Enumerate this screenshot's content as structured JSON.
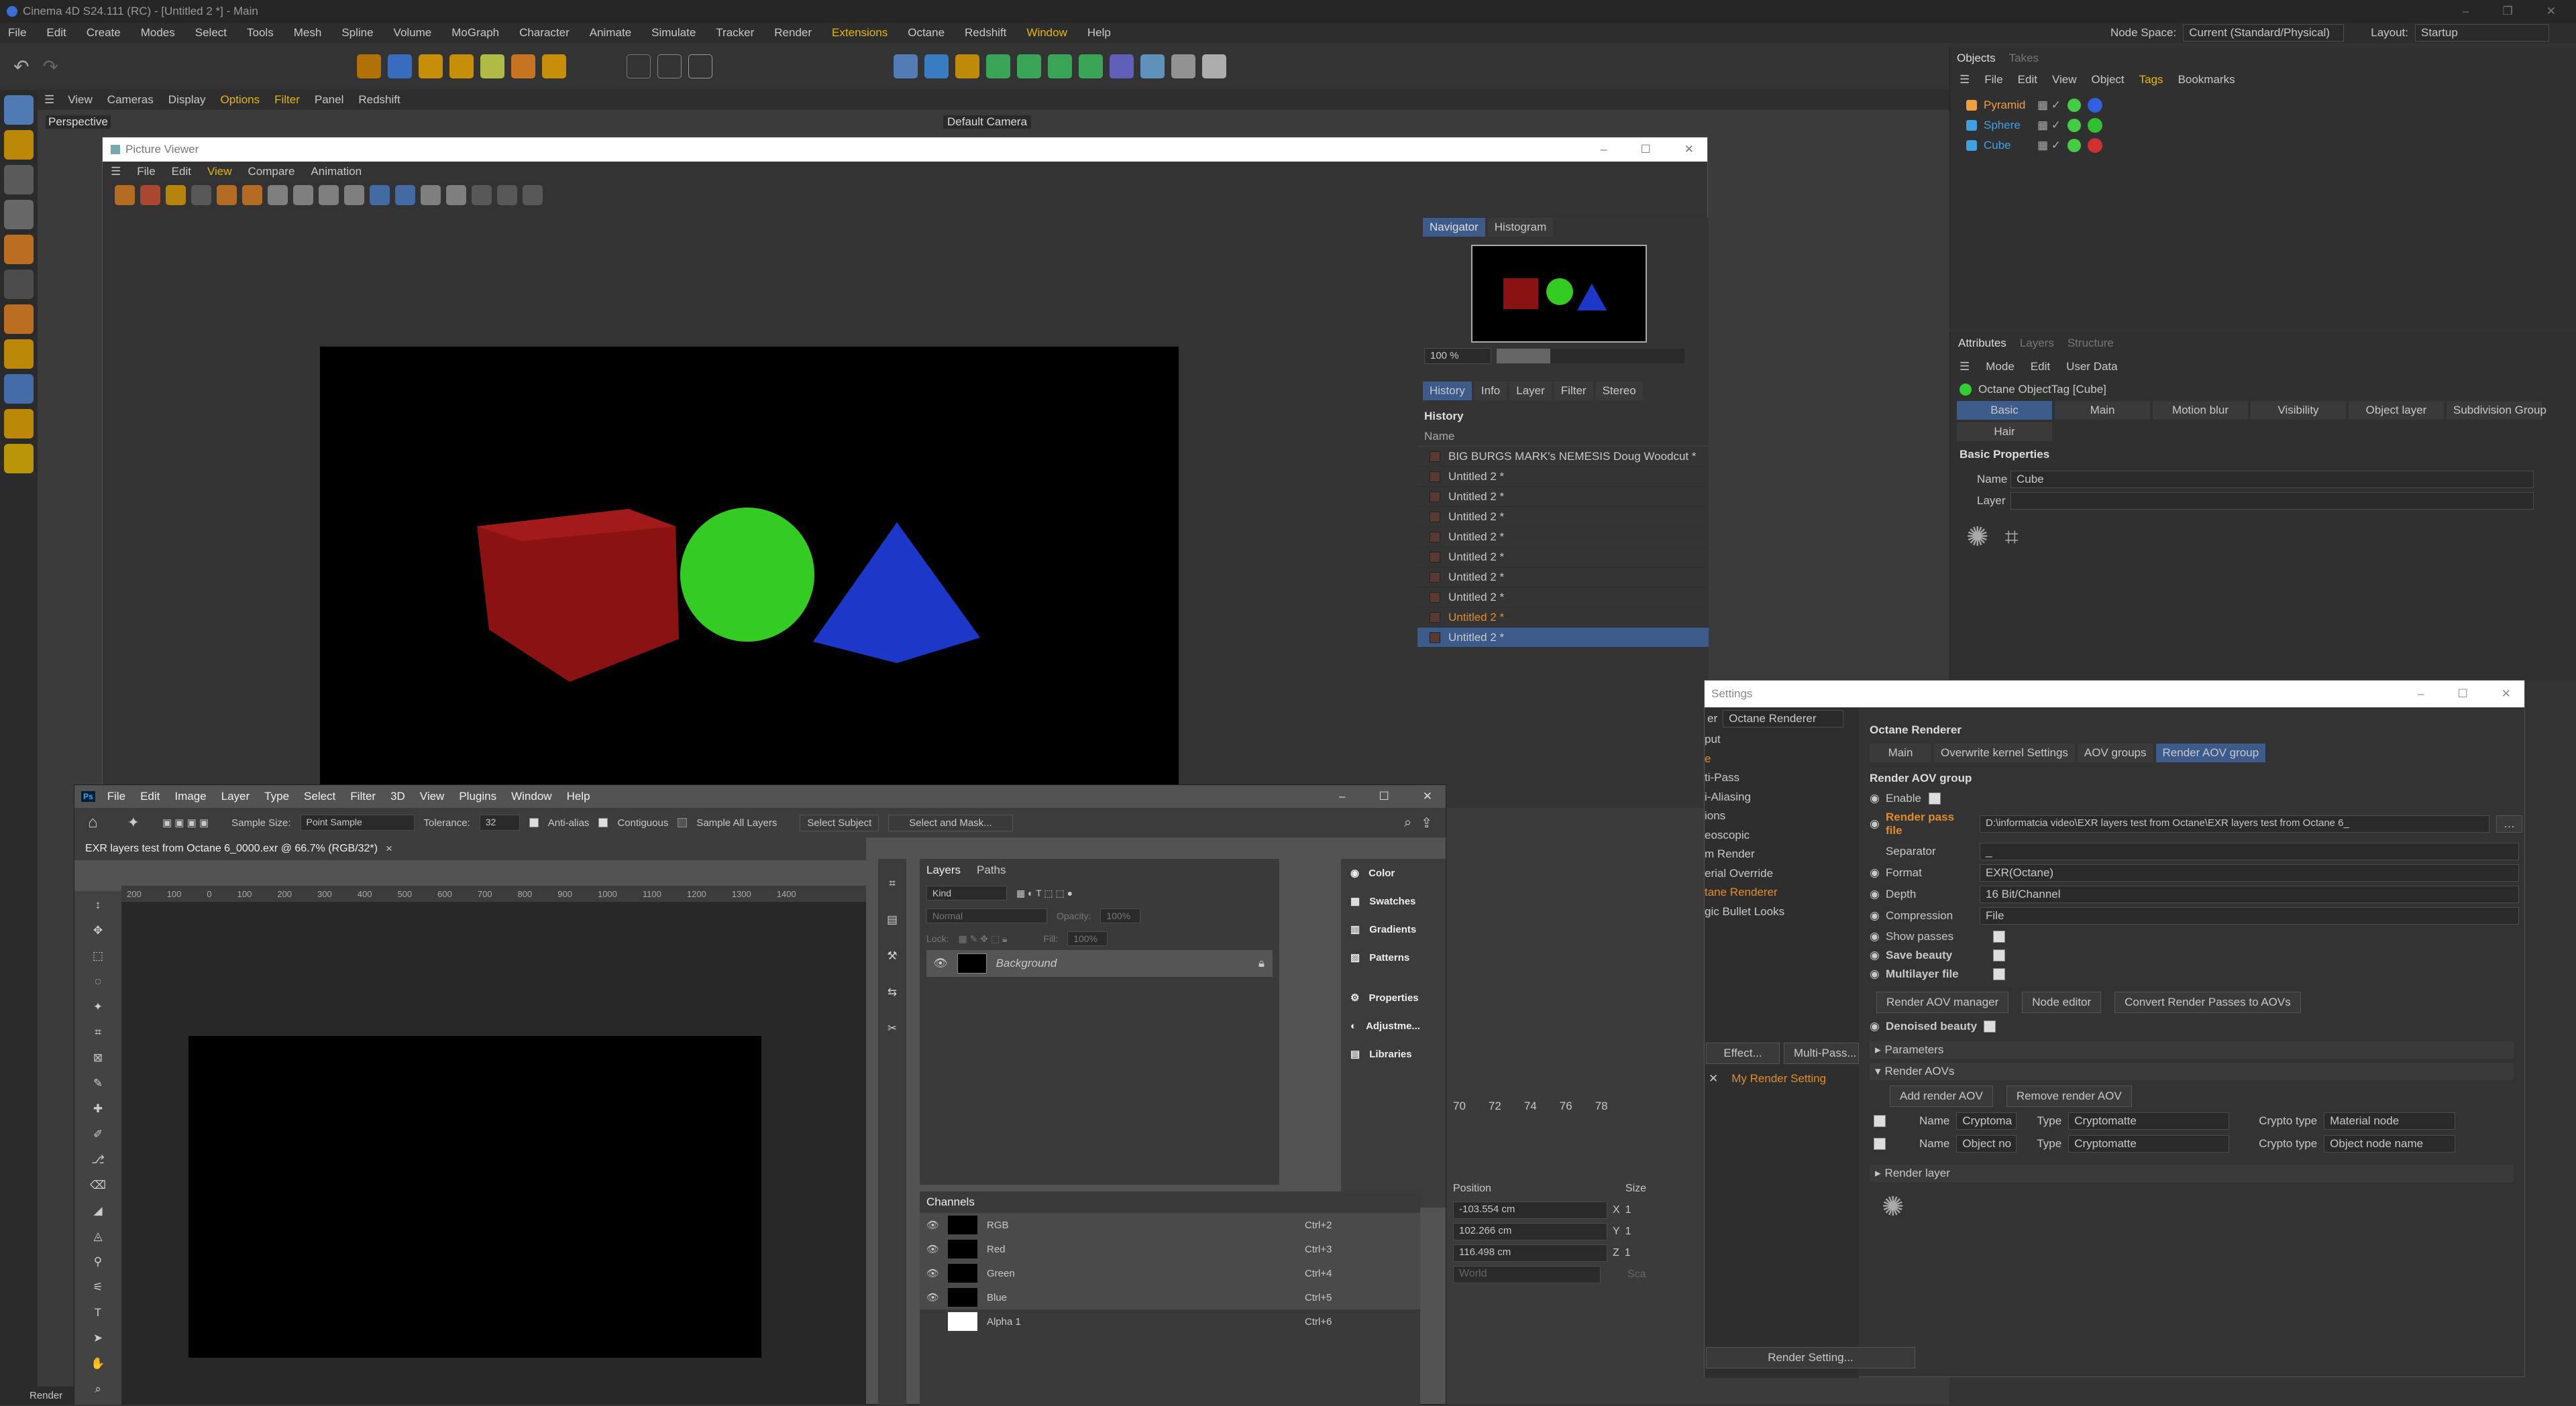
{
  "titlebar": {
    "title": "Cinema 4D S24.111 (RC) - [Untitled 2 *] - Main"
  },
  "menubar": {
    "items": [
      "File",
      "Edit",
      "Create",
      "Modes",
      "Select",
      "Tools",
      "Mesh",
      "Spline",
      "Volume",
      "MoGraph",
      "Character",
      "Animate",
      "Simulate",
      "Tracker",
      "Render",
      "Extensions",
      "Octane",
      "Redshift",
      "Window",
      "Help"
    ],
    "node_space_label": "Node Space:",
    "node_space_value": "Current (Standard/Physical)",
    "layout_label": "Layout:",
    "layout_value": "Startup"
  },
  "viewport": {
    "menu": [
      "View",
      "Cameras",
      "Display",
      "Options",
      "Filter",
      "Panel",
      "Redshift"
    ],
    "label": "Perspective",
    "camera": "Default Camera"
  },
  "objects_panel": {
    "tabs": [
      "Objects",
      "Takes"
    ],
    "menu": [
      "File",
      "Edit",
      "View",
      "Object",
      "Tags",
      "Bookmarks"
    ],
    "objects": [
      {
        "name": "Pyramid",
        "color": "#f0a040",
        "tag": "#3060e0"
      },
      {
        "name": "Sphere",
        "color": "#40a0e0",
        "tag": "#30c030"
      },
      {
        "name": "Cube",
        "color": "#40a0e0",
        "tag": "#d03030"
      }
    ]
  },
  "attributes": {
    "tabs": [
      "Attributes",
      "Layers",
      "Structure"
    ],
    "menu": [
      "Mode",
      "Edit",
      "User Data"
    ],
    "tag_title": "Octane ObjectTag [Cube]",
    "subtabs": [
      "Basic",
      "Main",
      "Motion blur",
      "Visibility",
      "Object layer",
      "Subdivision Group"
    ],
    "subtab2": "Hair",
    "section": "Basic Properties",
    "name_label": "Name",
    "name_value": "Cube",
    "layer_label": "Layer"
  },
  "picture_viewer": {
    "title": "Picture Viewer",
    "menu": [
      "File",
      "Edit",
      "View",
      "Compare",
      "Animation"
    ],
    "nav_tabs": [
      "Navigator",
      "Histogram"
    ],
    "zoom": "100 %",
    "tabs": [
      "History",
      "Info",
      "Layer",
      "Filter",
      "Stereo"
    ],
    "history_title": "History",
    "col_name": "Name",
    "history": [
      "BIG BURGS MARK's NEMESIS Doug Woodcut *",
      "Untitled 2 *",
      "Untitled 2 *",
      "Untitled 2 *",
      "Untitled 2 *",
      "Untitled 2 *",
      "Untitled 2 *",
      "Untitled 2 *",
      "Untitled 2 *",
      "Untitled 2 *"
    ]
  },
  "render_settings": {
    "title": "Settings",
    "renderer_label": "er",
    "renderer": "Octane Renderer",
    "left_items": [
      "put",
      "e",
      "ti-Pass",
      "i-Aliasing",
      "ions",
      "eoscopic",
      "m Render",
      "erial Override",
      "tane Renderer",
      "gic Bullet Looks"
    ],
    "effect_btn": "Effect...",
    "multipass_btn": "Multi-Pass...",
    "my_setting": "My Render Setting",
    "render_setting_btn": "Render Setting...",
    "header": "Octane Renderer",
    "tabs": [
      "Main",
      "Overwrite kernel Settings",
      "AOV groups",
      "Render AOV group"
    ],
    "group_title": "Render AOV group",
    "enable": "Enable",
    "render_pass_file": "Render pass file",
    "path": "D:\\informatcia video\\EXR layers test from Octane\\EXR layers test from Octane 6_",
    "separator": "Separator",
    "separator_value": "_",
    "format": "Format",
    "format_value": "EXR(Octane)",
    "depth": "Depth",
    "depth_value": "16 Bit/Channel",
    "compression": "Compression",
    "compression_value": "File",
    "show_passes": "Show passes",
    "save_beauty": "Save beauty",
    "multilayer": "Multilayer file",
    "btns": [
      "Render AOV manager",
      "Node editor",
      "Convert Render Passes to AOVs"
    ],
    "denoised": "Denoised beauty",
    "parameters": "Parameters",
    "render_aovs": "Render AOVs",
    "add_aov": "Add render AOV",
    "remove_aov": "Remove render AOV",
    "aovs": [
      {
        "name_label": "Name",
        "name": "Cryptoma",
        "type_label": "Type",
        "type": "Cryptomatte",
        "crypto_label": "Crypto type",
        "crypto": "Material node"
      },
      {
        "name_label": "Name",
        "name": "Object no",
        "type_label": "Type",
        "type": "Cryptomatte",
        "crypto_label": "Crypto type",
        "crypto": "Object node name"
      }
    ],
    "render_layer": "Render layer"
  },
  "timeline": {
    "ticks": [
      "70",
      "72",
      "74",
      "76",
      "78"
    ]
  },
  "coords": {
    "title": "Position",
    "size_label": "Size",
    "x": "-103.554 cm",
    "y": "102.266 cm",
    "z": "116.498 cm",
    "sx": "1",
    "sy": "1",
    "sz": "1",
    "world": "World",
    "sca": "Sca"
  },
  "photoshop": {
    "menu": [
      "File",
      "Edit",
      "Image",
      "Layer",
      "Type",
      "Select",
      "Filter",
      "3D",
      "View",
      "Plugins",
      "Window",
      "Help"
    ],
    "sample_size_label": "Sample Size:",
    "sample_size": "Point Sample",
    "tolerance_label": "Tolerance:",
    "tolerance": "32",
    "antialias": "Anti-alias",
    "contiguous": "Contiguous",
    "sample_all": "Sample All Layers",
    "select_subject": "Select Subject",
    "select_mask": "Select and Mask...",
    "doc_tab": "EXR layers test from Octane 6_0000.exr @ 66.7% (RGB/32*)",
    "ruler": [
      "200",
      "100",
      "0",
      "100",
      "200",
      "300",
      "400",
      "500",
      "600",
      "700",
      "800",
      "900",
      "1000",
      "1100",
      "1200",
      "1300",
      "1400"
    ],
    "layers_tabs": [
      "Layers",
      "Paths"
    ],
    "kind": "Kind",
    "normal": "Normal",
    "opacity": "Opacity:",
    "opacity_v": "100%",
    "lock": "Lock:",
    "fill": "Fill:",
    "fill_v": "100%",
    "layer_name": "Background",
    "side_panels": [
      "Color",
      "Swatches",
      "Gradients",
      "Patterns",
      "Properties",
      "Adjustme...",
      "Libraries"
    ],
    "channels_title": "Channels",
    "channels": [
      {
        "name": "RGB",
        "key": "Ctrl+2"
      },
      {
        "name": "Red",
        "key": "Ctrl+3"
      },
      {
        "name": "Green",
        "key": "Ctrl+4"
      },
      {
        "name": "Blue",
        "key": "Ctrl+5"
      },
      {
        "name": "Alpha 1",
        "key": "Ctrl+6"
      }
    ]
  },
  "statusbar": {
    "text": "Render"
  }
}
